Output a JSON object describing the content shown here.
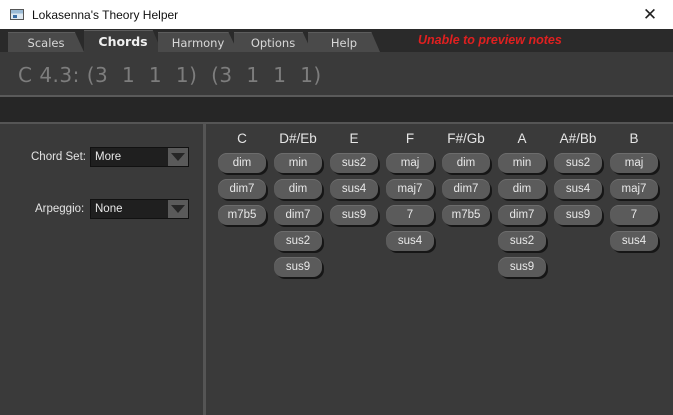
{
  "window": {
    "title": "Lokasenna's Theory Helper",
    "close_glyph": "✕",
    "icon": "app-window-icon"
  },
  "tabs": {
    "items": [
      "Scales",
      "Chords",
      "Harmony",
      "Options",
      "Help"
    ],
    "active": "Chords",
    "status": "Unable to preview notes",
    "status_color": "#e02020"
  },
  "header": {
    "chord_display": "C 4.3: (3  1  1  1)  (3  1  1  1)"
  },
  "left": {
    "chord_set_label": "Chord Set:",
    "chord_set_value": "More",
    "arpeggio_label": "Arpeggio:",
    "arpeggio_value": "None"
  },
  "grid": {
    "columns": [
      {
        "note": "C",
        "chords": [
          "dim",
          "dim7",
          "m7b5"
        ]
      },
      {
        "note": "D#/Eb",
        "chords": [
          "min",
          "dim",
          "dim7",
          "sus2",
          "sus9"
        ]
      },
      {
        "note": "E",
        "chords": [
          "sus2",
          "sus4",
          "sus9"
        ]
      },
      {
        "note": "F",
        "chords": [
          "maj",
          "maj7",
          "7",
          "sus4"
        ]
      },
      {
        "note": "F#/Gb",
        "chords": [
          "dim",
          "dim7",
          "m7b5"
        ]
      },
      {
        "note": "A",
        "chords": [
          "min",
          "dim",
          "dim7",
          "sus2",
          "sus9"
        ]
      },
      {
        "note": "A#/Bb",
        "chords": [
          "sus2",
          "sus4",
          "sus9"
        ]
      },
      {
        "note": "B",
        "chords": [
          "maj",
          "maj7",
          "7",
          "sus4"
        ]
      }
    ]
  },
  "colors": {
    "background": "#3a3a3a",
    "chip": "#5b5b5b",
    "text": "#e6e6e6"
  }
}
